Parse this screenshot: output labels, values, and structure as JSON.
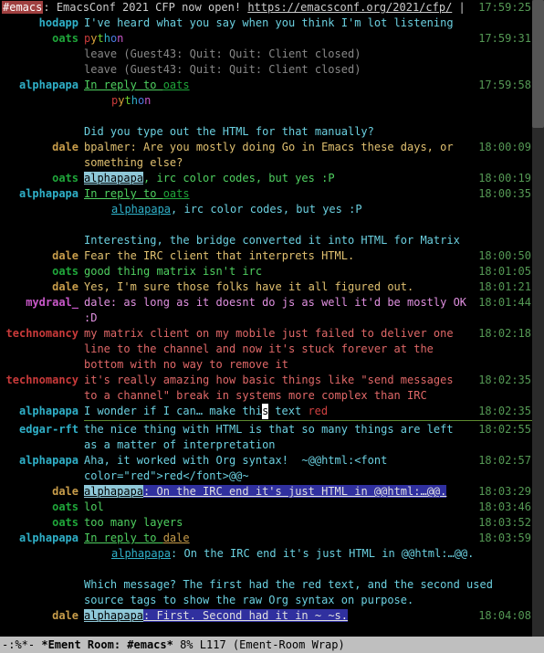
{
  "colors": {
    "hodapp": "#2fb0c8",
    "oats": "#1fa63a",
    "alphapapa": "#2fb0c8",
    "dale": "#c79c4a",
    "technomancy": "#c93a3a",
    "edgar-rft": "#2fb0c8",
    "mydraal_": "#c858c8"
  },
  "topic": {
    "channel": "#emacs",
    "sep1": ": ",
    "text1": "EmacsConf 2021 CFP now open! ",
    "url": "https://emacsconf.org/2021/cfp/",
    "rest": " | \"Emacs is a co",
    "ts": "17:59:25"
  },
  "scrollbar": {
    "top": 0,
    "height": 140
  },
  "lines": [
    {
      "kind": "msg",
      "sender": "hodapp",
      "ts": "",
      "segments": [
        {
          "t": "I've heard what you say when you think I'm lot listening",
          "c": "#6bd0e0"
        }
      ]
    },
    {
      "kind": "msg",
      "sender": "oats",
      "ts": "17:59:31",
      "segments": [
        {
          "t": "p",
          "c": "#c93a3a"
        },
        {
          "t": "y",
          "c": "#d8a23a"
        },
        {
          "t": "t",
          "c": "#6bd030"
        },
        {
          "t": "h",
          "c": "#2fb0c8"
        },
        {
          "t": "o",
          "c": "#4a7ae0"
        },
        {
          "t": "n",
          "c": "#c858c8"
        }
      ]
    },
    {
      "kind": "notice",
      "sender": "",
      "ts": "",
      "segments": [
        {
          "t": "leave (Guest43: Quit: Quit: Client closed)"
        }
      ]
    },
    {
      "kind": "notice",
      "sender": "",
      "ts": "",
      "segments": [
        {
          "t": "leave (Guest43: Quit: Quit: Client closed)"
        }
      ]
    },
    {
      "kind": "msg",
      "sender": "alphapapa",
      "ts": "17:59:58",
      "segments": [
        {
          "t": "In reply to ",
          "c": "#4fd060",
          "u": true
        },
        {
          "t": "oats",
          "c": "#1fa63a",
          "u": true
        }
      ]
    },
    {
      "kind": "cont",
      "indent": 30,
      "segments": [
        {
          "t": "p",
          "c": "#c93a3a"
        },
        {
          "t": "y",
          "c": "#d8a23a"
        },
        {
          "t": "t",
          "c": "#6bd030"
        },
        {
          "t": "h",
          "c": "#2fb0c8"
        },
        {
          "t": "o",
          "c": "#4a7ae0"
        },
        {
          "t": "n",
          "c": "#c858c8"
        }
      ]
    },
    {
      "kind": "blank"
    },
    {
      "kind": "msg",
      "sender": "",
      "ts": "",
      "segments": [
        {
          "t": "Did you type out the HTML for that manually?",
          "c": "#6bd0e0"
        }
      ]
    },
    {
      "kind": "msg",
      "sender": "dale",
      "ts": "18:00:09",
      "segments": [
        {
          "t": "bpalmer: Are you mostly doing Go in Emacs these days, or something else?",
          "c": "#e0c070"
        }
      ]
    },
    {
      "kind": "msg",
      "sender": "oats",
      "ts": "18:00:19",
      "segments": [
        {
          "t": "alphapapa",
          "hl": "#8fc8d8"
        },
        {
          "t": ", irc color codes, but yes :P",
          "c": "#4fd060"
        }
      ]
    },
    {
      "kind": "msg",
      "sender": "alphapapa",
      "ts": "18:00:35",
      "segments": [
        {
          "t": "In reply to ",
          "c": "#4fd060",
          "u": true
        },
        {
          "t": "oats",
          "c": "#1fa63a",
          "u": true
        }
      ]
    },
    {
      "kind": "cont",
      "indent": 30,
      "segments": [
        {
          "t": "alphapapa",
          "c": "#2fb0c8",
          "u": true
        },
        {
          "t": ", irc color codes, but yes :P",
          "c": "#6bd0e0"
        }
      ]
    },
    {
      "kind": "blank"
    },
    {
      "kind": "msg",
      "sender": "",
      "ts": "",
      "segments": [
        {
          "t": "Interesting, the bridge converted it into HTML for Matrix",
          "c": "#6bd0e0"
        }
      ]
    },
    {
      "kind": "msg",
      "sender": "dale",
      "ts": "18:00:50",
      "segments": [
        {
          "t": "Fear the IRC client that interprets HTML.",
          "c": "#e0c070"
        }
      ]
    },
    {
      "kind": "msg",
      "sender": "oats",
      "ts": "18:01:05",
      "segments": [
        {
          "t": "good thing matrix isn't irc",
          "c": "#4fd060"
        }
      ]
    },
    {
      "kind": "msg",
      "sender": "dale",
      "ts": "18:01:21",
      "segments": [
        {
          "t": "Yes, I'm sure those folks have it all figured out.",
          "c": "#e0c070"
        }
      ]
    },
    {
      "kind": "msg",
      "sender": "mydraal_",
      "ts": "18:01:44",
      "segments": [
        {
          "t": "dale: as long as it doesnt do js as well it'd be mostly OK :D",
          "c": "#e090e0"
        }
      ]
    },
    {
      "kind": "msg",
      "sender": "technomancy",
      "ts": "18:02:18",
      "segments": [
        {
          "t": "my matrix client on my mobile just failed to deliver one line to the channel and now it's stuck forever at the bottom with no way to remove it",
          "c": "#e06868"
        }
      ]
    },
    {
      "kind": "msg",
      "sender": "technomancy",
      "ts": "18:02:35",
      "segments": [
        {
          "t": "it's really amazing how basic things like \"send messages to a channel\" break in systems more complex than IRC",
          "c": "#e06868"
        }
      ]
    },
    {
      "kind": "msg",
      "sender": "alphapapa",
      "ts": "18:02:35",
      "segments": [
        {
          "t": "I wonder if I can… make thi",
          "c": "#6bd0e0"
        },
        {
          "t": "s",
          "cursor": true
        },
        {
          "t": " text ",
          "c": "#6bd0e0"
        },
        {
          "t": "red",
          "c": "#d04040"
        }
      ]
    },
    {
      "kind": "rule"
    },
    {
      "kind": "msg",
      "sender": "edgar-rft",
      "ts": "18:02:55",
      "segments": [
        {
          "t": "the nice thing with HTML is that so many things are left as a matter of interpretation",
          "c": "#6bd0e0"
        }
      ]
    },
    {
      "kind": "msg",
      "sender": "alphapapa",
      "ts": "18:02:57",
      "segments": [
        {
          "t": "Aha, it worked with Org syntax!  ~@@html:<font color=\"red\">red</font>@@~",
          "c": "#6bd0e0"
        }
      ]
    },
    {
      "kind": "msg",
      "sender": "dale",
      "ts": "18:03:29",
      "segments": [
        {
          "t": "alphapapa",
          "hl": "#8fc8d8"
        },
        {
          "t": ": On the IRC end it's just HTML in @@html:…@@.",
          "hl": "#30309f",
          "hlc": "#e0e0e0"
        }
      ]
    },
    {
      "kind": "msg",
      "sender": "oats",
      "ts": "18:03:46",
      "segments": [
        {
          "t": "lol",
          "c": "#4fd060"
        }
      ]
    },
    {
      "kind": "msg",
      "sender": "oats",
      "ts": "18:03:52",
      "segments": [
        {
          "t": "too many layers",
          "c": "#4fd060"
        }
      ]
    },
    {
      "kind": "msg",
      "sender": "alphapapa",
      "ts": "18:03:59",
      "segments": [
        {
          "t": "In reply to ",
          "c": "#4fd060",
          "u": true
        },
        {
          "t": "dale",
          "c": "#c79c4a",
          "u": true
        }
      ]
    },
    {
      "kind": "cont",
      "indent": 30,
      "segments": [
        {
          "t": "alphapapa",
          "c": "#2fb0c8",
          "u": true
        },
        {
          "t": ": On the IRC end it's just HTML in @@html:…@@.",
          "c": "#6bd0e0"
        }
      ]
    },
    {
      "kind": "blank"
    },
    {
      "kind": "msg",
      "sender": "",
      "ts": "",
      "segments": [
        {
          "t": "Which message? The first had the red text, and the second used source tags to show the raw Org syntax on purpose.",
          "c": "#6bd0e0"
        }
      ]
    },
    {
      "kind": "msg",
      "sender": "dale",
      "ts": "18:04:08",
      "segments": [
        {
          "t": "alphapapa",
          "hl": "#8fc8d8"
        },
        {
          "t": ": First. Second had it in ~ ~s.",
          "hl": "#30309f",
          "hlc": "#e0e0e0"
        }
      ]
    }
  ],
  "modeline": {
    "left": "-:%*-  ",
    "buffer": "*Ement Room: #emacs*",
    "pos": "   8% ",
    "line": "L117",
    "mode": "   (Ement-Room Wrap)"
  }
}
